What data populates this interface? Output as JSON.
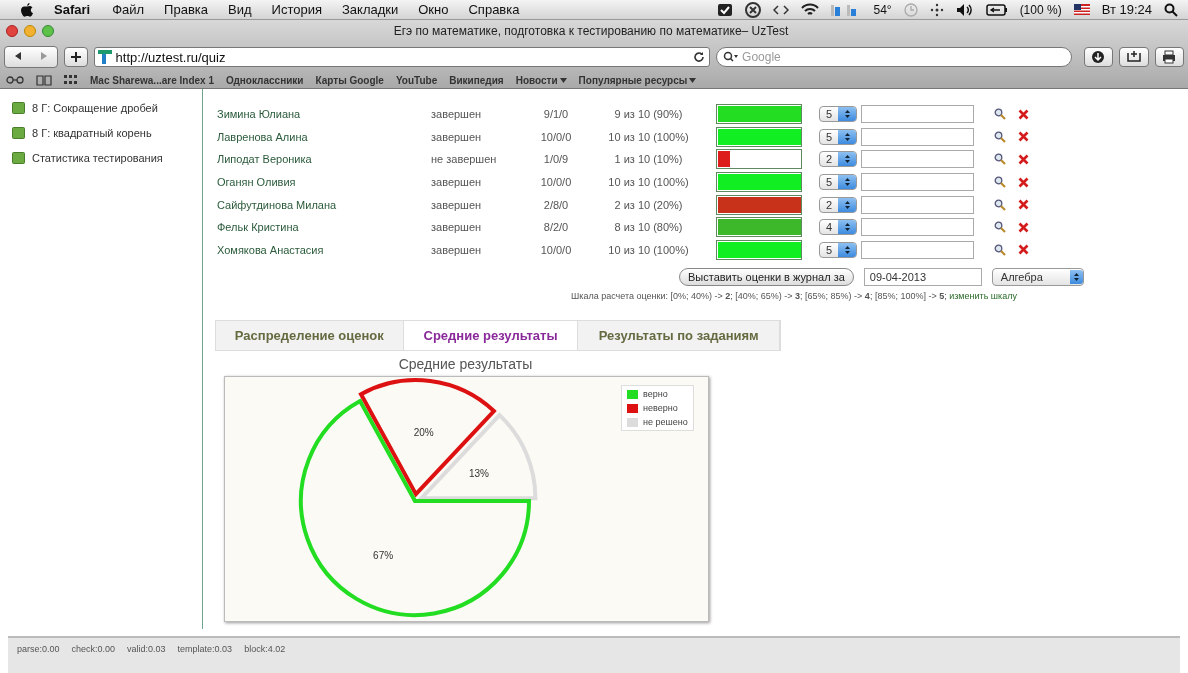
{
  "menubar": {
    "app": "Safari",
    "menus": [
      "Файл",
      "Правка",
      "Вид",
      "История",
      "Закладки",
      "Окно",
      "Справка"
    ],
    "temperature": "54°",
    "battery": "(100 %)",
    "clock": "Вт 19:24"
  },
  "window": {
    "title": "Егэ по математике, подготовка к тестированию по математике– UzTest"
  },
  "toolbar": {
    "url": "http://uztest.ru/quiz",
    "search": {
      "placeholder": "Google"
    }
  },
  "bookmarks": [
    {
      "label": "Mac Sharewa...are Index 1",
      "menu": false
    },
    {
      "label": "Одноклассники",
      "menu": false
    },
    {
      "label": "Карты Google",
      "menu": false
    },
    {
      "label": "YouTube",
      "menu": false
    },
    {
      "label": "Википедия",
      "menu": false
    },
    {
      "label": "Новости",
      "menu": true
    },
    {
      "label": "Популярные ресурсы",
      "menu": true
    }
  ],
  "sidebar": {
    "items": [
      "8 Г: Сокращение дробей",
      "8 Г: квадратный корень",
      "Статистика тестирования"
    ]
  },
  "results": {
    "rows": [
      {
        "name": "Зимина Юлиана",
        "status": "завершен",
        "answers": "9/1/0",
        "score": "9 из 10 (90%)",
        "level": 1,
        "color": "#22dd22",
        "grade": "5"
      },
      {
        "name": "Лавренова Алина",
        "status": "завершен",
        "answers": "10/0/0",
        "score": "10 из 10 (100%)",
        "level": 1,
        "color": "#11ee22",
        "grade": "5"
      },
      {
        "name": "Липодат Вероника",
        "status": "не завершен",
        "answers": "1/0/9",
        "score": "1 из 10 (10%)",
        "level": 0.15,
        "color": "#dd1c1c",
        "grade": "2"
      },
      {
        "name": "Оганян Оливия",
        "status": "завершен",
        "answers": "10/0/0",
        "score": "10 из 10 (100%)",
        "level": 1,
        "color": "#11ee22",
        "grade": "5"
      },
      {
        "name": "Сайфутдинова Милана",
        "status": "завершен",
        "answers": "2/8/0",
        "score": "2 из 10 (20%)",
        "level": 1,
        "color": "#c8321a",
        "grade": "2"
      },
      {
        "name": "Фельк Кристина",
        "status": "завершен",
        "answers": "8/2/0",
        "score": "8 из 10 (80%)",
        "level": 1,
        "color": "#3cb82a",
        "grade": "4"
      },
      {
        "name": "Хомякова Анастасия",
        "status": "завершен",
        "answers": "10/0/0",
        "score": "10 из 10 (100%)",
        "level": 1,
        "color": "#11ee22",
        "grade": "5"
      }
    ]
  },
  "journal": {
    "button": "Выставить оценки в журнал за",
    "date": "09-04-2013",
    "subject": "Алгебра"
  },
  "scale": {
    "text": "Шкала расчета оценки: [0%; 40%) -> **2**; [40%; 65%) -> **3**; [65%; 85%) -> **4**; [85%; 100%] -> **5**;",
    "link": "изменить шкалу"
  },
  "tabs": [
    {
      "label": "Распределение оценок",
      "selected": false
    },
    {
      "label": "Средние результаты",
      "selected": true
    },
    {
      "label": "Результаты по заданиям",
      "selected": false
    }
  ],
  "chart": {
    "chart_data": {
      "type": "pie",
      "title": "Средние результаты",
      "categories": [
        "верно",
        "неверно",
        "не решено"
      ],
      "colors": [
        "#22dd22",
        "#dd1111",
        "#dcdcdc"
      ],
      "values": [
        67,
        20,
        13
      ],
      "value_labels": [
        "67%",
        "20%",
        "13%"
      ],
      "legend": true
    }
  },
  "status_bar": [
    "parse:0.00",
    "check:0.00",
    "valid:0.03",
    "template:0.03",
    "block:4.02"
  ]
}
